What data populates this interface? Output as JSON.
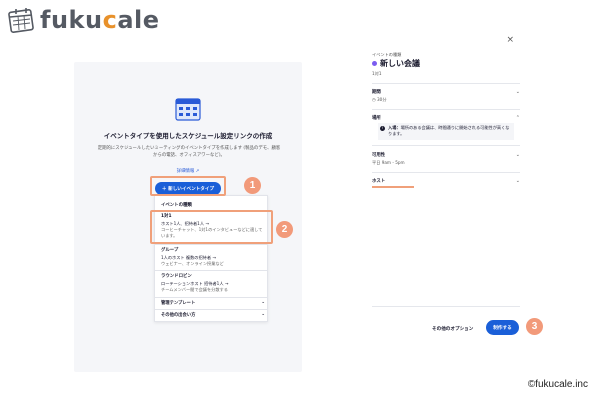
{
  "brand": {
    "logo_text_pre": "fuku",
    "logo_text_accent": "c",
    "logo_text_post": "ale",
    "accent_color": "#e8912b"
  },
  "left_panel": {
    "title": "イベントタイプを使用したスケジュール設定リンクの作成",
    "description": "定期的にスケジュールしたいミーティングのイベントタイプを作成します (製品のデモ、顧客からの電話、オフィスアワーなど)。",
    "learn_more": "詳細情報 ↗",
    "new_event_button": "＋ 新しいイベントタイプ",
    "dropdown": {
      "header": "イベントの種類",
      "items": [
        {
          "title": "1対1",
          "subtitle": "ホスト1人、招待者1人 →",
          "desc": "コーヒーチャット、1対1のインタビューなどに適しています。"
        },
        {
          "title": "グループ",
          "subtitle": "1人のホスト 複数の招待者 →",
          "desc": "ウェビナー、オンライン授業など"
        },
        {
          "title": "ラウンドロビン",
          "subtitle": "ローテーションホスト 招待者1人 →",
          "desc": "チームメンバー間で会議を分散する"
        }
      ],
      "rows": [
        {
          "label": "管理テンプレート",
          "chevron": "⌄"
        },
        {
          "label": "その他の出会い方",
          "chevron": "⌄"
        }
      ]
    }
  },
  "right_panel": {
    "close": "×",
    "event_type_label": "イベントの種類",
    "event_name": "新しい会議",
    "event_kind": "1対1",
    "duration_label": "期間",
    "duration_value": "30分",
    "location_label": "場所",
    "location_warning": "場所のある会議は、時間通りに開始される可能性が高くなります。",
    "location_warning_head": "入場：",
    "availability_label": "可用性",
    "availability_value": "平日 9am - 5pm",
    "host_label": "ホスト",
    "more_options": "その他のオプション",
    "create_button": "制作する"
  },
  "callouts": [
    "1",
    "2",
    "3"
  ],
  "credit": "©fukucale.inc",
  "colors": {
    "primary": "#1a5fd8",
    "highlight": "#f0a07a",
    "badge": "#f29a7a",
    "event_dot": "#7b5cf0"
  }
}
